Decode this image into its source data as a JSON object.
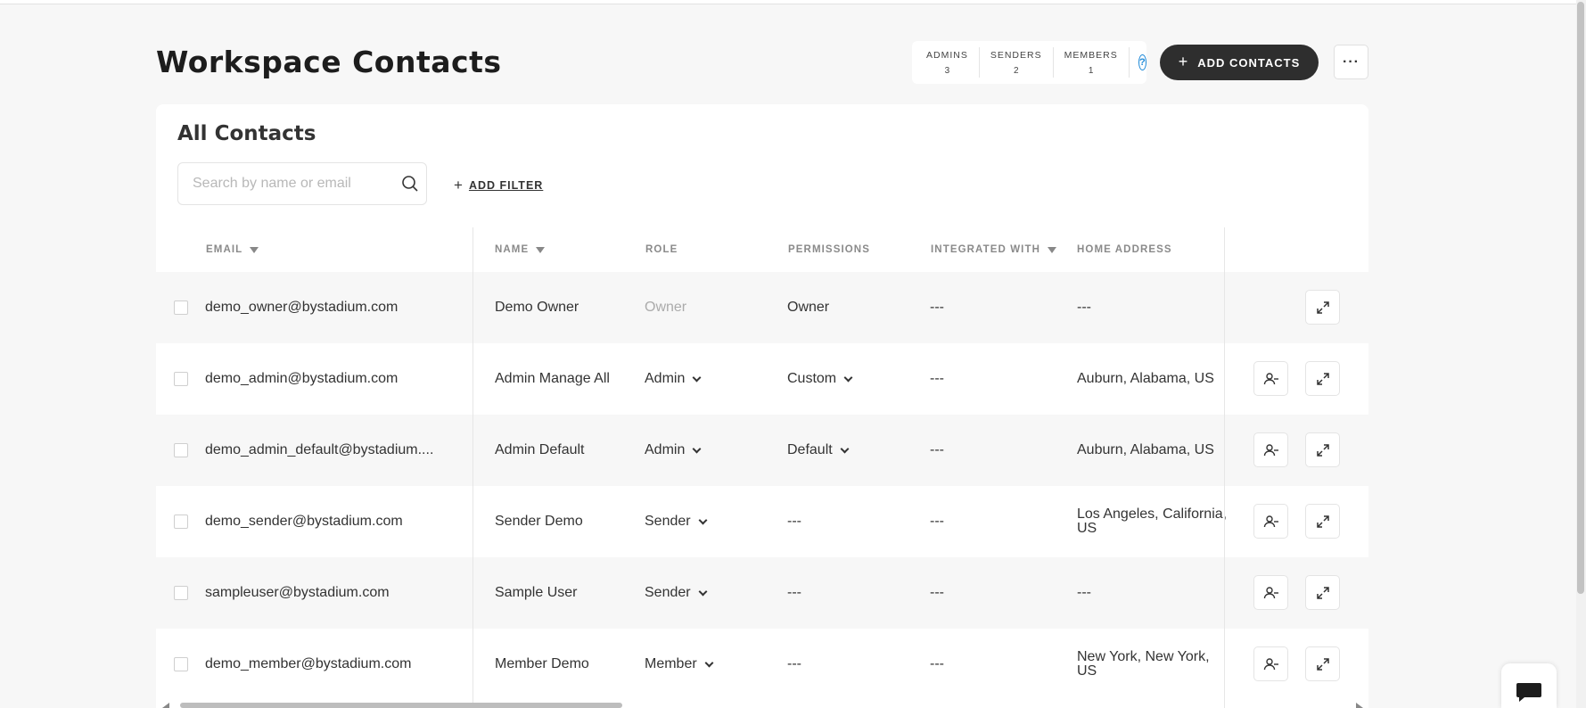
{
  "page": {
    "title": "Workspace Contacts"
  },
  "counts": [
    {
      "label": "ADMINS",
      "value": "3"
    },
    {
      "label": "SENDERS",
      "value": "2"
    },
    {
      "label": "MEMBERS",
      "value": "1"
    }
  ],
  "help_icon": "?",
  "header_actions": {
    "add_contacts": "ADD CONTACTS",
    "more": "···"
  },
  "card": {
    "title": "All Contacts",
    "search_placeholder": "Search by name or email",
    "add_filter": "ADD FILTER"
  },
  "columns": {
    "email": "EMAIL",
    "name": "NAME",
    "role": "ROLE",
    "permissions": "PERMISSIONS",
    "integrated": "INTEGRATED WITH",
    "address": "HOME ADDRESS"
  },
  "rows": [
    {
      "email": "demo_owner@bystadium.com",
      "name": "Demo Owner",
      "role": "Owner",
      "permissions": "Owner",
      "integrated": "---",
      "address": "---"
    },
    {
      "email": "demo_admin@bystadium.com",
      "name": "Admin Manage All",
      "role": "Admin",
      "permissions": "Custom",
      "integrated": "---",
      "address": "Auburn, Alabama, US"
    },
    {
      "email": "demo_admin_default@bystadium....",
      "name": "Admin Default",
      "role": "Admin",
      "permissions": "Default",
      "integrated": "---",
      "address": "Auburn, Alabama, US"
    },
    {
      "email": "demo_sender@bystadium.com",
      "name": "Sender Demo",
      "role": "Sender",
      "permissions": "---",
      "integrated": "---",
      "address": "Los Angeles, California, US"
    },
    {
      "email": "sampleuser@bystadium.com",
      "name": "Sample User",
      "role": "Sender",
      "permissions": "---",
      "integrated": "---",
      "address": "---"
    },
    {
      "email": "demo_member@bystadium.com",
      "name": "Member Demo",
      "role": "Member",
      "permissions": "---",
      "integrated": "---",
      "address": "New York, New York, US"
    }
  ],
  "icons": {
    "search": "search-icon",
    "remove_user": "remove-user-icon",
    "expand": "expand-icon",
    "chat": "chat-icon"
  }
}
